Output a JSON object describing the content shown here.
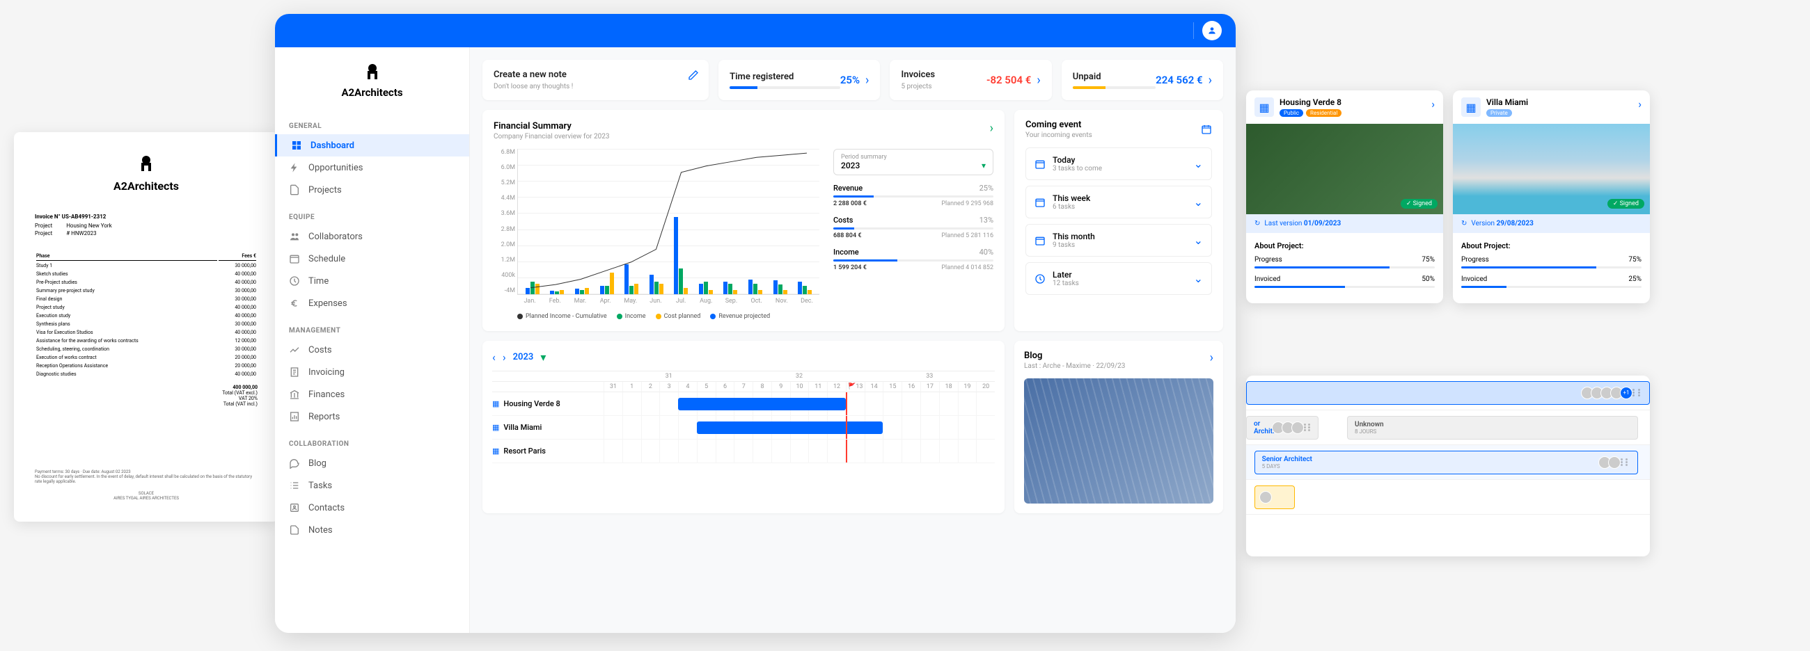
{
  "brand": "A2Architects",
  "invoice": {
    "title": "Invoice N° US-AB4991-2312",
    "project_label": "Project",
    "project_value": "Housing New York",
    "ref_label": "Project",
    "ref_value": "# HNW2023",
    "columns": [
      "Phase",
      "Fees €"
    ],
    "lines": [
      {
        "phase": "Study 1",
        "fee": "30 000,00"
      },
      {
        "phase": "Sketch studies",
        "fee": "40 000,00"
      },
      {
        "phase": "Pre-Project studies",
        "fee": "40 000,00"
      },
      {
        "phase": "Summary pre-project study",
        "fee": "30 000,00"
      },
      {
        "phase": "Final design",
        "fee": "30 000,00"
      },
      {
        "phase": "Project study",
        "fee": "40 000,00"
      },
      {
        "phase": "Execution study",
        "fee": "40 000,00"
      },
      {
        "phase": "Synthesis plans",
        "fee": "30 000,00"
      },
      {
        "phase": "Visa for Execution Studios",
        "fee": "40 000,00"
      },
      {
        "phase": "Assistance for the awarding of works contracts",
        "fee": "12 000,00"
      },
      {
        "phase": "Scheduling, steering, coordination",
        "fee": "30 000,00"
      },
      {
        "phase": "Execution of works contract",
        "fee": "20 000,00"
      },
      {
        "phase": "Reception Operations Assistance",
        "fee": "20 000,00"
      },
      {
        "phase": "Diagnostic studies",
        "fee": "40 000,00"
      }
    ],
    "total_line": "400 000,00",
    "totals": [
      "Total (VAT excl.)",
      "VAT 20%",
      "Total (VAT incl.)"
    ],
    "footer1": "Payment terms: 30 days · Due date: August 02 2023",
    "footer2": "No discount for early settlement. In the event of delay, default interest shall be calculated on the basis of the statutory rate legally applicable.",
    "footer_center1": "SOLACE",
    "footer_center2": "AIRES TYGAL AIRES ARCHITECTES"
  },
  "sidebar": {
    "sections": [
      {
        "title": "GENERAL",
        "items": [
          {
            "label": "Dashboard",
            "icon": "dashboard",
            "active": true
          },
          {
            "label": "Opportunities",
            "icon": "bolt"
          },
          {
            "label": "Projects",
            "icon": "doc"
          }
        ]
      },
      {
        "title": "EQUIPE",
        "items": [
          {
            "label": "Collaborators",
            "icon": "people"
          },
          {
            "label": "Schedule",
            "icon": "calendar"
          },
          {
            "label": "Time",
            "icon": "clock"
          },
          {
            "label": "Expenses",
            "icon": "euro"
          }
        ]
      },
      {
        "title": "MANAGEMENT",
        "items": [
          {
            "label": "Costs",
            "icon": "trend"
          },
          {
            "label": "Invoicing",
            "icon": "receipt"
          },
          {
            "label": "Finances",
            "icon": "bank"
          },
          {
            "label": "Reports",
            "icon": "report"
          }
        ]
      },
      {
        "title": "COLLABORATION",
        "items": [
          {
            "label": "Blog",
            "icon": "chat"
          },
          {
            "label": "Tasks",
            "icon": "list"
          },
          {
            "label": "Contacts",
            "icon": "contact"
          },
          {
            "label": "Notes",
            "icon": "note"
          }
        ]
      }
    ]
  },
  "kpis": {
    "create_note": {
      "title": "Create a new note",
      "subtitle": "Don't loose any thoughts !"
    },
    "time": {
      "title": "Time registered",
      "value": "25%",
      "progress": 25
    },
    "invoices": {
      "title": "Invoices",
      "subtitle": "5 projects",
      "value": "-82 504 €"
    },
    "unpaid": {
      "title": "Unpaid",
      "value": "224 562 €",
      "progress": 40
    }
  },
  "financial": {
    "title": "Financial Summary",
    "subtitle": "Company Financial overview for 2023",
    "period_label": "Period summary",
    "period_value": "2023",
    "yaxis": [
      "6.8M",
      "6.0M",
      "5.2M",
      "4.4M",
      "3.6M",
      "2.8M",
      "2.0M",
      "1.2M",
      "400k",
      "-4M"
    ],
    "months": [
      "Jan.",
      "Feb.",
      "Mar.",
      "Apr.",
      "May.",
      "Jun.",
      "Jul.",
      "Aug.",
      "Sep.",
      "Oct.",
      "Nov.",
      "Dec."
    ],
    "legend": [
      "Planned Income - Cumulative",
      "Income",
      "Cost planned",
      "Revenue projected"
    ],
    "metrics": [
      {
        "name": "Revenue",
        "pct": "25%",
        "actual": "2 288 008 €",
        "planned": "Planned 9 295 968",
        "fill": 25
      },
      {
        "name": "Costs",
        "pct": "13%",
        "actual": "688 804 €",
        "planned": "Planned 5 281 116",
        "fill": 13
      },
      {
        "name": "Income",
        "pct": "40%",
        "actual": "1 599 204 €",
        "planned": "Planned 4 014 852",
        "fill": 40
      }
    ]
  },
  "chart_data": {
    "type": "bar",
    "title": "Financial Summary",
    "categories": [
      "Jan.",
      "Feb.",
      "Mar.",
      "Apr.",
      "May.",
      "Jun.",
      "Jul.",
      "Aug.",
      "Sep.",
      "Oct.",
      "Nov.",
      "Dec."
    ],
    "ylim": [
      -400000,
      6800000
    ],
    "series": [
      {
        "name": "Revenue projected",
        "color": "#0066ff",
        "values": [
          300000,
          150000,
          250000,
          400000,
          1400000,
          900000,
          3600000,
          500000,
          600000,
          700000,
          650000,
          600000
        ]
      },
      {
        "name": "Income",
        "color": "#00a862",
        "values": [
          600000,
          100000,
          200000,
          400000,
          400000,
          600000,
          1200000,
          600000,
          500000,
          500000,
          450000,
          400000
        ]
      },
      {
        "name": "Cost planned",
        "color": "#ffb800",
        "values": [
          500000,
          200000,
          300000,
          1000000,
          500000,
          500000,
          300000,
          200000,
          200000,
          200000,
          200000,
          200000
        ]
      },
      {
        "name": "Planned Income - Cumulative",
        "type": "line",
        "color": "#333",
        "values": [
          300000,
          450000,
          700000,
          1100000,
          1500000,
          2100000,
          5700000,
          6000000,
          6200000,
          6400000,
          6500000,
          6600000
        ]
      }
    ]
  },
  "events": {
    "title": "Coming event",
    "subtitle": "Your incoming events",
    "items": [
      {
        "title": "Today",
        "subtitle": "3 tasks to come"
      },
      {
        "title": "This week",
        "subtitle": "6 tasks"
      },
      {
        "title": "This month",
        "subtitle": "9 tasks"
      },
      {
        "title": "Later",
        "subtitle": "12 tasks"
      }
    ]
  },
  "gantt": {
    "year": "2023",
    "weeks": [
      "31",
      "32",
      "33"
    ],
    "days": [
      "31",
      "1",
      "2",
      "3",
      "4",
      "5",
      "6",
      "7",
      "8",
      "9",
      "10",
      "11",
      "12",
      "13",
      "14",
      "15",
      "16",
      "17",
      "18",
      "19",
      "20"
    ],
    "projects": [
      {
        "name": "Housing Verde 8",
        "start": 4,
        "width": 9
      },
      {
        "name": "Villa Miami",
        "start": 5,
        "width": 10
      },
      {
        "name": "Resort Paris",
        "start": 0,
        "width": 0
      }
    ],
    "today_col": 13
  },
  "blog": {
    "title": "Blog",
    "subtitle": "Last : Arche - Maxime  ·  22/09/23"
  },
  "projects": [
    {
      "name": "Housing Verde 8",
      "badges": [
        {
          "text": "Public",
          "cls": "public"
        },
        {
          "text": "Residential",
          "cls": "residential"
        }
      ],
      "signed": "Signed",
      "version_label": "Last version",
      "version_date": "01/09/2023",
      "about": "About Project:",
      "stats": [
        {
          "label": "Progress",
          "value": "75%",
          "fill": 75
        },
        {
          "label": "Invoiced",
          "value": "50%",
          "fill": 50
        }
      ]
    },
    {
      "name": "Villa Miami",
      "badges": [
        {
          "text": "Private",
          "cls": "private"
        }
      ],
      "signed": "Signed",
      "version_label": "Version",
      "version_date": "29/08/2023",
      "about": "About Project:",
      "stats": [
        {
          "label": "Progress",
          "value": "75%",
          "fill": 75
        },
        {
          "label": "Invoiced",
          "value": "25%",
          "fill": 25
        }
      ]
    }
  ],
  "timeline": {
    "rows": [
      {
        "title": "",
        "sub": "",
        "cls": "blue",
        "left": 0,
        "width": 100,
        "avatars": 5,
        "badge": "+1"
      },
      {
        "title": "or Archit.",
        "sub": "",
        "cls": "grey",
        "left": 0,
        "width": 18,
        "avatars": 3
      },
      {
        "title2": "Unknown",
        "sub2": "8 JOURS",
        "cls2": "grey",
        "left2": 25,
        "width2": 70
      },
      {
        "title": "Senior Architect",
        "sub": "5 DAYS",
        "cls": "light",
        "left": 2,
        "width": 95,
        "avatars": 2
      },
      {
        "title": "",
        "sub": "",
        "cls": "yellow",
        "left": 2,
        "width": 10,
        "avatars": 1
      }
    ]
  }
}
